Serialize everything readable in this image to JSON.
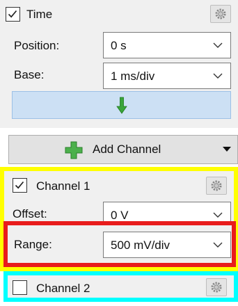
{
  "time": {
    "label": "Time",
    "checked": true,
    "position": {
      "label": "Position:",
      "value": "0 s"
    },
    "base": {
      "label": "Base:",
      "value": "1 ms/div"
    },
    "apply_icon": "green-down-arrow-icon",
    "settings_icon": "gear-icon"
  },
  "add_channel": {
    "label": "Add Channel",
    "icon": "green-plus-icon",
    "dropdown_icon": "triangle-down-icon"
  },
  "channel1": {
    "label": "Channel 1",
    "checked": true,
    "offset": {
      "label": "Offset:",
      "value": "0 V"
    },
    "range": {
      "label": "Range:",
      "value": "500 mV/div"
    },
    "settings_icon": "gear-icon"
  },
  "channel2": {
    "label": "Channel 2",
    "checked": false,
    "settings_icon": "gear-icon"
  },
  "colors": {
    "panel_bg": "#f0f0f0",
    "apply_button_bg": "#cce0f4",
    "apply_button_border": "#9cc0e6",
    "highlight_yellow": "#ffff00",
    "highlight_red": "#e81c1c",
    "highlight_cyan": "#00ffff",
    "arrow_green": "#3aa53a"
  }
}
